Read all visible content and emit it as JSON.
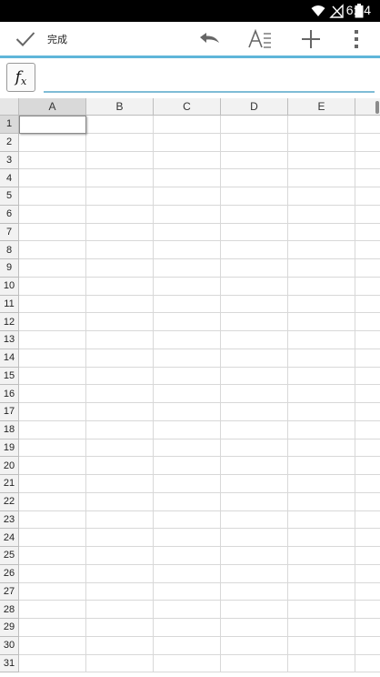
{
  "status_bar": {
    "time": "6:24",
    "icons": [
      "wifi-icon",
      "signal-icon",
      "battery-icon"
    ]
  },
  "toolbar": {
    "done_label": "完成",
    "icons": [
      "check-icon",
      "undo-icon",
      "text-format-icon",
      "add-icon",
      "more-vert-icon"
    ],
    "accent_color": "#5fb6d9"
  },
  "formula_bar": {
    "fx_label": "f",
    "fx_sub": "x",
    "value": "",
    "placeholder": ""
  },
  "sheet": {
    "columns": [
      "A",
      "B",
      "C",
      "D",
      "E"
    ],
    "rows": [
      "1",
      "2",
      "3",
      "4",
      "5",
      "6",
      "7",
      "8",
      "9",
      "10",
      "11",
      "12",
      "13",
      "14",
      "15",
      "16",
      "17",
      "18",
      "19",
      "20",
      "21",
      "22",
      "23",
      "24",
      "25",
      "26",
      "27",
      "28",
      "29",
      "30",
      "31"
    ],
    "selected_cell": "A1"
  }
}
